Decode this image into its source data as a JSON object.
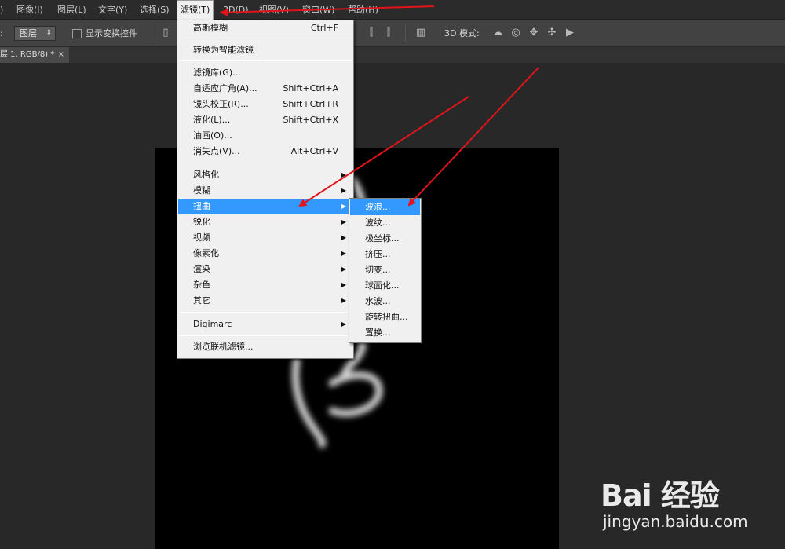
{
  "menubar": {
    "items": [
      ")",
      "图像(I)",
      "图层(L)",
      "文字(Y)",
      "选择(S)",
      "滤镜(T)",
      "3D(D)",
      "视图(V)",
      "窗口(W)",
      "帮助(H)"
    ]
  },
  "optbar": {
    "label_prefix": ":",
    "layer_select": "图层",
    "show_transform": "显示变换控件",
    "mode_3d": "3D 模式:"
  },
  "tab": {
    "title": "层 1, RGB/8) *",
    "close": "×"
  },
  "filter_menu": {
    "items": [
      {
        "label": "高斯模糊",
        "shortcut": "Ctrl+F"
      },
      {
        "label": "转换为智能滤镜",
        "shortcut": ""
      },
      {
        "label": "滤镜库(G)...",
        "shortcut": ""
      },
      {
        "label": "自适应广角(A)...",
        "shortcut": "Shift+Ctrl+A"
      },
      {
        "label": "镜头校正(R)...",
        "shortcut": "Shift+Ctrl+R"
      },
      {
        "label": "液化(L)...",
        "shortcut": "Shift+Ctrl+X"
      },
      {
        "label": "油画(O)...",
        "shortcut": ""
      },
      {
        "label": "消失点(V)...",
        "shortcut": "Alt+Ctrl+V"
      },
      {
        "label": "风格化",
        "shortcut": ""
      },
      {
        "label": "模糊",
        "shortcut": ""
      },
      {
        "label": "扭曲",
        "shortcut": ""
      },
      {
        "label": "锐化",
        "shortcut": ""
      },
      {
        "label": "视频",
        "shortcut": ""
      },
      {
        "label": "像素化",
        "shortcut": ""
      },
      {
        "label": "渲染",
        "shortcut": ""
      },
      {
        "label": "杂色",
        "shortcut": ""
      },
      {
        "label": "其它",
        "shortcut": ""
      },
      {
        "label": "Digimarc",
        "shortcut": ""
      },
      {
        "label": "浏览联机滤镜...",
        "shortcut": ""
      }
    ]
  },
  "distort_submenu": {
    "items": [
      "波浪...",
      "波纹...",
      "极坐标...",
      "挤压...",
      "切变...",
      "球面化...",
      "水波...",
      "旋转扭曲...",
      "置换..."
    ]
  },
  "watermark": {
    "logo": "Bai 经验",
    "url": "jingyan.baidu.com"
  },
  "colors": {
    "highlight": "#3399ff",
    "arrow": "#e0141a",
    "menu_bg": "#f0f0f0"
  }
}
